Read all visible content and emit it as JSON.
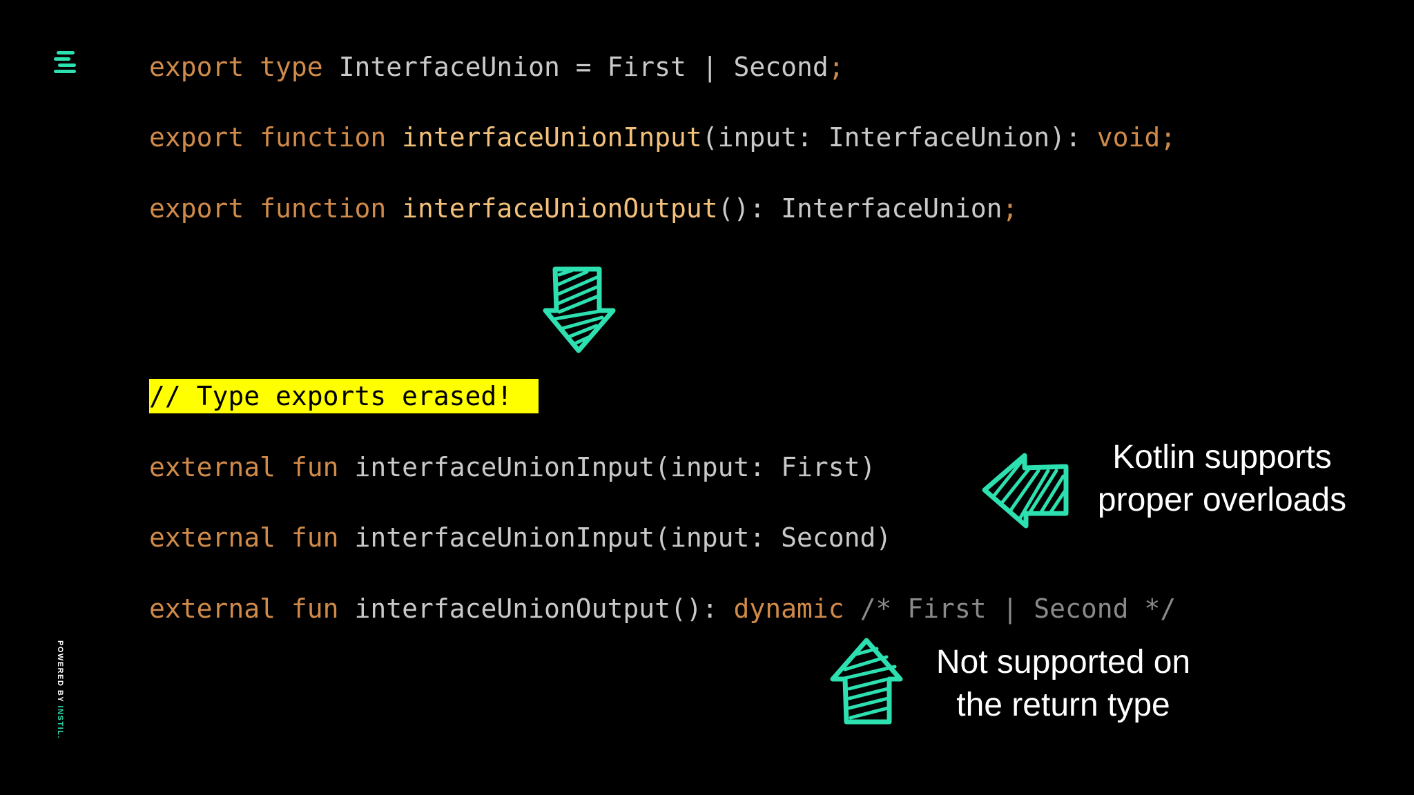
{
  "brand": {
    "logo_icon": "instil-logo-icon",
    "powered_prefix": "POWERED BY ",
    "powered_brand": "INSTIL.",
    "accent_color": "#2de0b0"
  },
  "typescript": {
    "line1": {
      "kw1": "export",
      "kw2": "type",
      "text": "InterfaceUnion = First | Second",
      "semi": ";"
    },
    "line2": {
      "kw1": "export",
      "kw2": "function",
      "fn": "interfaceUnionInput",
      "params": "(input: InterfaceUnion): ",
      "ret": "void",
      "semi": ";"
    },
    "line3": {
      "kw1": "export",
      "kw2": "function",
      "fn": "interfaceUnionOutput",
      "params": "(): InterfaceUnion",
      "semi": ";"
    }
  },
  "down_arrow_icon": "down-arrow-icon",
  "erased_comment": "// Type exports erased! ",
  "kotlin": {
    "line1": {
      "kw1": "external",
      "kw2": "fun",
      "rest": "interfaceUnionInput(input: First)"
    },
    "line2": {
      "kw1": "external",
      "kw2": "fun",
      "rest": "interfaceUnionInput(input: Second)"
    },
    "line3": {
      "kw1": "external",
      "kw2": "fun",
      "rest": "interfaceUnionOutput(): ",
      "dyn": "dynamic",
      "comment": "/* First | Second */"
    }
  },
  "callouts": {
    "overloads_line1": "Kotlin supports",
    "overloads_line2": "proper overloads",
    "return_line1": "Not supported on",
    "return_line2": "the return type"
  }
}
